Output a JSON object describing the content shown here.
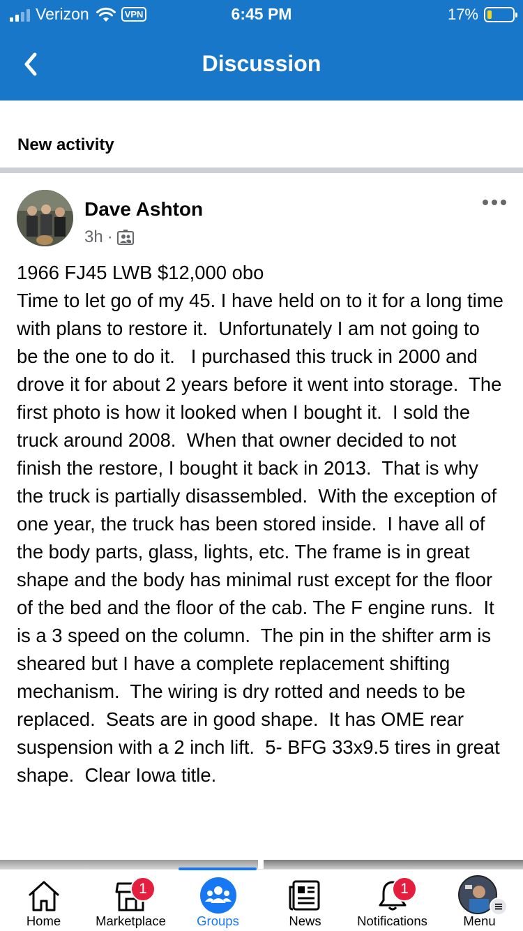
{
  "status_bar": {
    "carrier": "Verizon",
    "vpn": "VPN",
    "time": "6:45 PM",
    "battery": "17%"
  },
  "nav": {
    "title": "Discussion"
  },
  "section": {
    "title": "New activity"
  },
  "post": {
    "author": "Dave Ashton",
    "time": "3h",
    "separator": "·",
    "audience_icon": "group-members-icon",
    "body": "1966 FJ45 LWB $12,000 obo\nTime to let go of my 45. I have held on to it for a long time with plans to restore it.  Unfortunately I am not going to be the one to do it.   I purchased this truck in 2000 and drove it for about 2 years before it went into storage.  The first photo is how it looked when I bought it.  I sold the truck around 2008.  When that owner decided to not finish the restore, I bought it back in 2013.  That is why the truck is partially disassembled.  With the exception of one year, the truck has been stored inside.  I have all of the body parts, glass, lights, etc. The frame is in great shape and the body has minimal rust except for the floor of the bed and the floor of the cab. The F engine runs.  It is a 3 speed on the column.  The pin in the shifter arm is sheared but I have a complete replacement shifting mechanism.  The wiring is dry rotted and needs to be replaced.  Seats are in good shape.  It has OME rear suspension with a 2 inch lift.  5- BFG 33x9.5 tires in great shape.  Clear Iowa title."
  },
  "tabs": [
    {
      "label": "Home",
      "icon": "home-icon"
    },
    {
      "label": "Marketplace",
      "icon": "marketplace-icon",
      "badge": "1"
    },
    {
      "label": "Groups",
      "icon": "groups-icon",
      "active": true
    },
    {
      "label": "News",
      "icon": "news-icon"
    },
    {
      "label": "Notifications",
      "icon": "bell-icon",
      "badge": "1"
    },
    {
      "label": "Menu",
      "icon": "menu-avatar-icon"
    }
  ],
  "colors": {
    "brand": "#1877c9",
    "active_tab": "#1877f2",
    "badge": "#e41e3f"
  }
}
